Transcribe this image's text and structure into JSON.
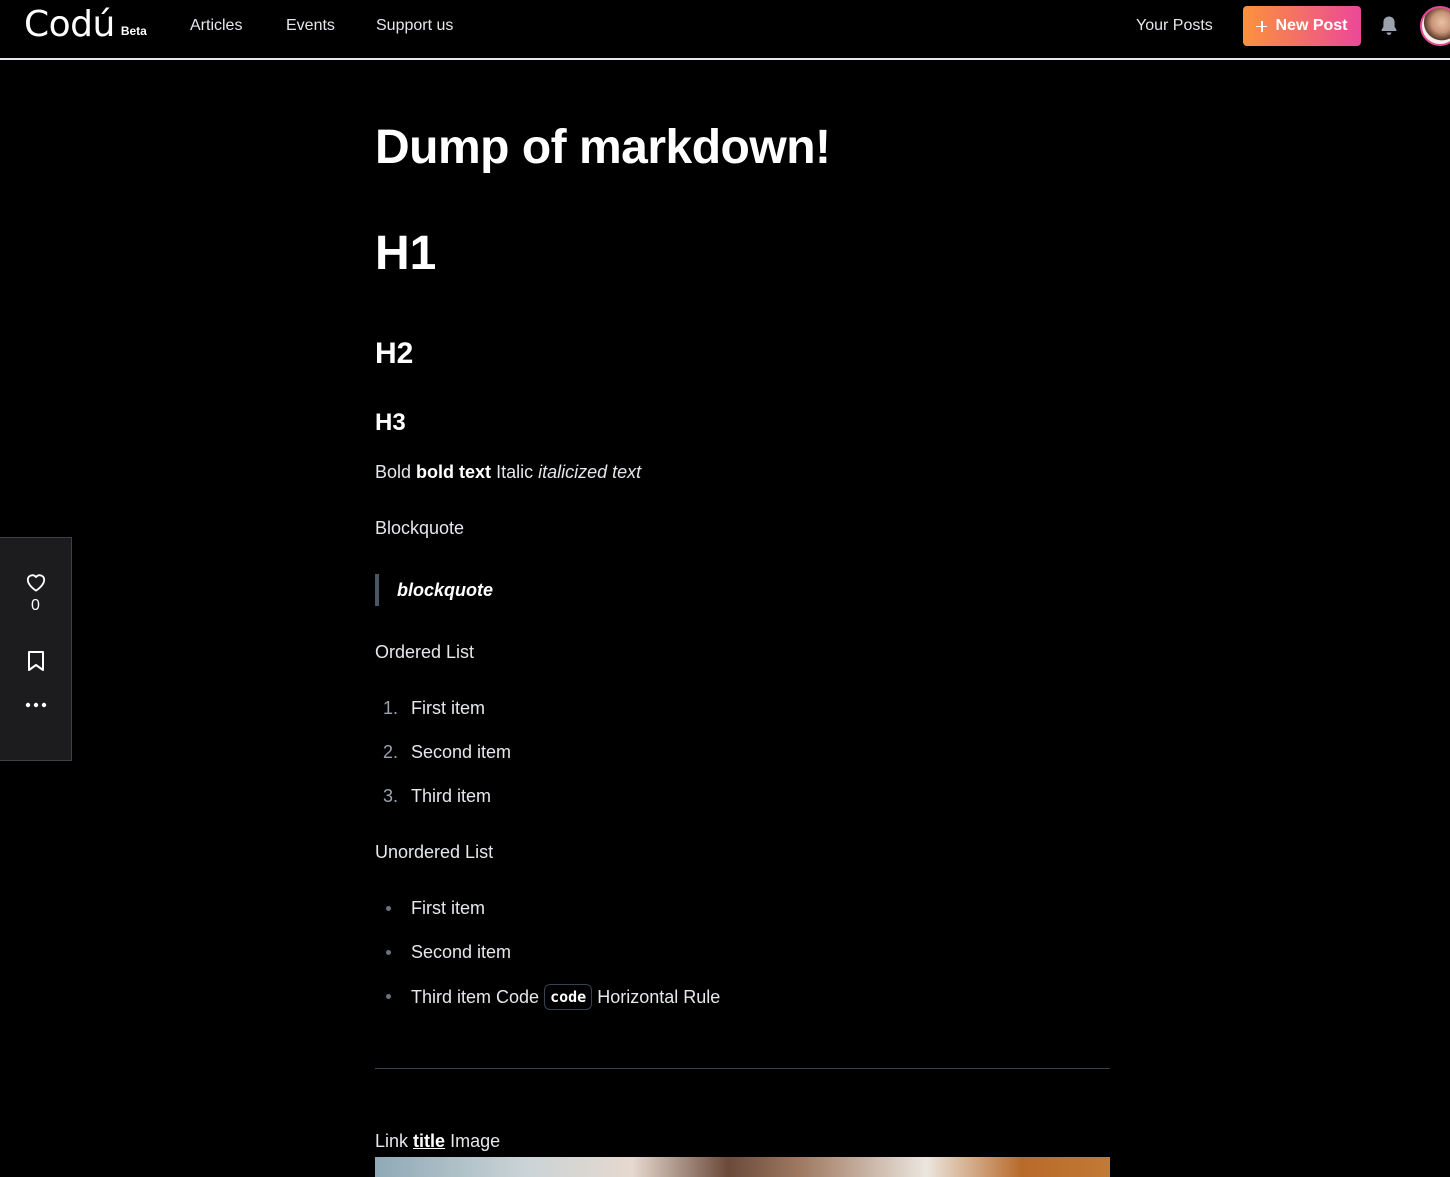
{
  "header": {
    "logo": "Codú",
    "logo_badge": "Beta",
    "nav": {
      "articles": "Articles",
      "events": "Events",
      "support": "Support us"
    },
    "your_posts": "Your Posts",
    "new_post": "New Post"
  },
  "article": {
    "title": "Dump of markdown!",
    "h1": "H1",
    "h2": "H2",
    "h3": "H3",
    "bold_label": "Bold",
    "bold_text": "bold text",
    "italic_label": "Italic",
    "italic_text": "italicized text",
    "blockquote_label": "Blockquote",
    "blockquote": "blockquote",
    "ordered_label": "Ordered List",
    "ordered_items": [
      "First item",
      "Second item",
      "Third item"
    ],
    "ordered_markers": [
      "1.",
      "2.",
      "3."
    ],
    "unordered_label": "Unordered List",
    "unordered_items": [
      "First item",
      "Second item",
      "Third item Code"
    ],
    "code": "code",
    "after_code": "Horizontal Rule",
    "link_label": "Link",
    "link_text": "title",
    "image_label": "Image"
  },
  "actions": {
    "like_count": "0"
  },
  "colors": {
    "background": "#000000",
    "accent_start": "#fb923c",
    "accent_end": "#ec4899",
    "muted_text": "#e5e7eb"
  },
  "icons": [
    "plus-icon",
    "bell-icon",
    "heart-icon",
    "bookmark-icon",
    "more-icon"
  ]
}
